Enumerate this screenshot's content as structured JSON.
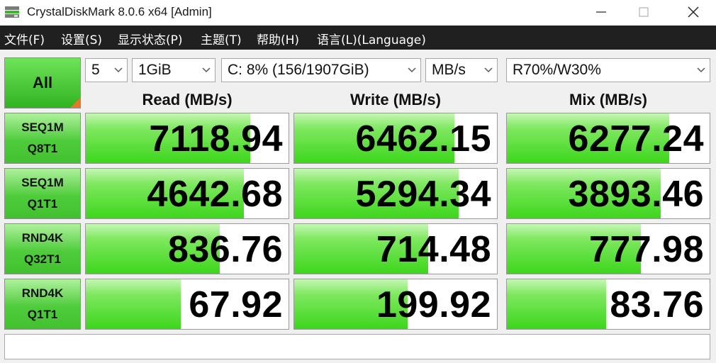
{
  "window": {
    "title": "CrystalDiskMark 8.0.6 x64 [Admin]"
  },
  "menu": [
    {
      "label": "文件(F)"
    },
    {
      "label": "设置(S)"
    },
    {
      "label": "显示状态(P)"
    },
    {
      "label": "主题(T)"
    },
    {
      "label": "帮助(H)"
    },
    {
      "label": "语言(L)(Language)"
    }
  ],
  "controls": {
    "all_label": "All",
    "count": "5",
    "size": "1GiB",
    "drive": "C: 8% (156/1907GiB)",
    "unit": "MB/s",
    "mix": "R70%/W30%"
  },
  "headers": {
    "read": "Read (MB/s)",
    "write": "Write (MB/s)",
    "mix": "Mix (MB/s)"
  },
  "rows": [
    {
      "line1": "SEQ1M",
      "line2": "Q8T1",
      "read": "7118.94",
      "write": "6462.15",
      "mix": "6277.24",
      "read_fill": 0.81,
      "write_fill": 0.79,
      "mix_fill": 0.8
    },
    {
      "line1": "SEQ1M",
      "line2": "Q1T1",
      "read": "4642.68",
      "write": "5294.34",
      "mix": "3893.46",
      "read_fill": 0.78,
      "write_fill": 0.81,
      "mix_fill": 0.76
    },
    {
      "line1": "RND4K",
      "line2": "Q32T1",
      "read": "836.76",
      "write": "714.48",
      "mix": "777.98",
      "read_fill": 0.66,
      "write_fill": 0.66,
      "mix_fill": 0.66
    },
    {
      "line1": "RND4K",
      "line2": "Q1T1",
      "read": "67.92",
      "write": "199.92",
      "mix": "83.76",
      "read_fill": 0.47,
      "write_fill": 0.56,
      "mix_fill": 0.49
    }
  ],
  "status": {
    "text": ""
  },
  "colors": {
    "accent_green": "#3dd61c",
    "corner_orange": "#e8772a",
    "menubar": "#202020"
  }
}
